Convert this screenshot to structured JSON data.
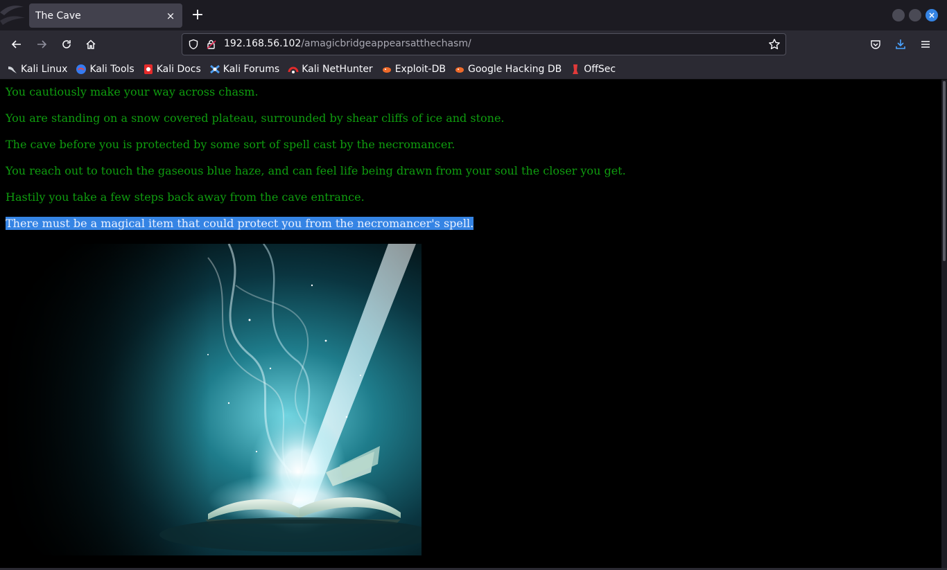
{
  "browser": {
    "tab": {
      "title": "The Cave",
      "close_glyph": "×"
    },
    "new_tab_glyph": "+",
    "close_window_glyph": "×",
    "url": {
      "host": "192.168.56.102",
      "path": "/amagicbridgeappearsatthechasm/"
    },
    "bookmarks": [
      {
        "label": "Kali Linux",
        "icon": "kali-dragon-icon",
        "color": "#cfd2d8"
      },
      {
        "label": "Kali Tools",
        "icon": "kali-tools-icon",
        "color": "#367bf0"
      },
      {
        "label": "Kali Docs",
        "icon": "kali-docs-icon",
        "color": "#e52b2b"
      },
      {
        "label": "Kali Forums",
        "icon": "kali-forums-icon",
        "color": "#4d9df0"
      },
      {
        "label": "Kali NetHunter",
        "icon": "nethunter-icon",
        "color": "#e02b2b"
      },
      {
        "label": "Exploit-DB",
        "icon": "exploit-db-icon",
        "color": "#ee6a2a"
      },
      {
        "label": "Google Hacking DB",
        "icon": "ghdb-icon",
        "color": "#ee6a2a"
      },
      {
        "label": "OffSec",
        "icon": "offsec-icon",
        "color": "#e03a3a"
      }
    ],
    "colors": {
      "tabstrip": "#1c1b22",
      "toolbar": "#2b2a33",
      "accent": "#3584e4",
      "download_icon": "#4aa3ff"
    }
  },
  "page": {
    "paragraphs": [
      "You cautiously make your way across chasm.",
      "You are standing on a snow covered plateau, surrounded by shear cliffs of ice and stone.",
      "The cave before you is protected by some sort of spell cast by the necromancer.",
      "You reach out to touch the gaseous blue haze, and can feel life being drawn from your soul the closer you get.",
      "Hastily you take a few steps back away from the cave entrance."
    ],
    "selected_paragraph": "There must be a magical item that could protect you from the necromancer's spell.",
    "image": "magic-book-glowing-illustration",
    "text_color": "#0f9d0f",
    "selection_color": "#3584e4"
  }
}
